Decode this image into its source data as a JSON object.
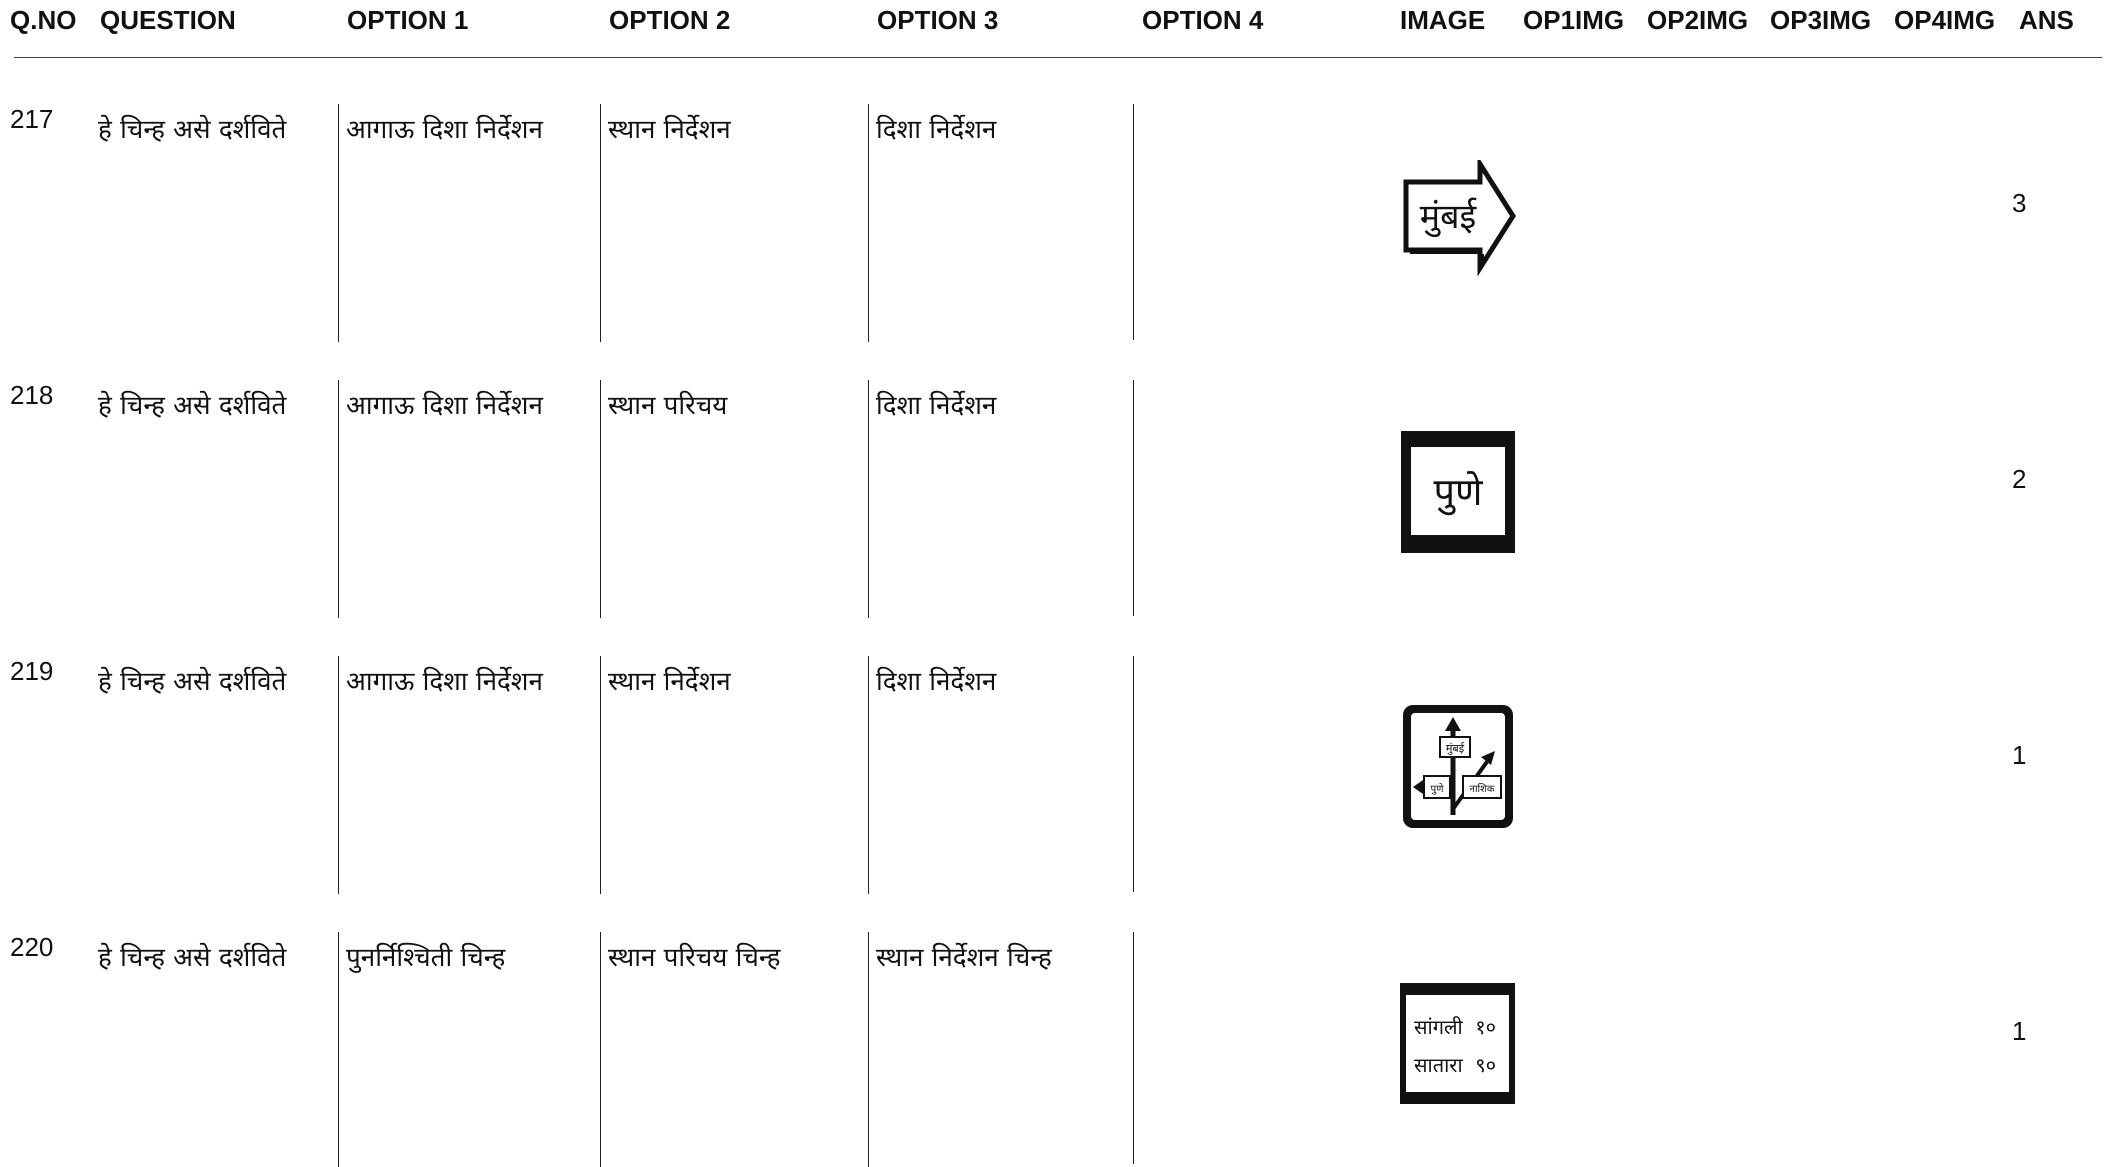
{
  "headers": [
    "Q.NO",
    "QUESTION",
    "OPTION 1",
    "OPTION 2",
    "OPTION 3",
    "OPTION 4",
    "IMAGE",
    "OP1IMG",
    "OP2IMG",
    "OP3IMG",
    "OP4IMG",
    "ANS"
  ],
  "rows": [
    {
      "qno": "217",
      "question": "हे चिन्ह असे दर्शविते",
      "option1": "आगाऊ दिशा निर्देशन",
      "option2": "स्थान निर्देशन",
      "option3": "दिशा निर्देशन",
      "option4": "",
      "image_icon": "arrow-sign-icon",
      "image_text": "मुंबई",
      "ans": "3"
    },
    {
      "qno": "218",
      "question": "हे चिन्ह असे दर्शविते",
      "option1": "आगाऊ दिशा निर्देशन",
      "option2": "स्थान परिचय",
      "option3": "दिशा निर्देशन",
      "option4": "",
      "image_icon": "place-sign-icon",
      "image_text": "पुणे",
      "ans": "2"
    },
    {
      "qno": "219",
      "question": "हे चिन्ह असे दर्शविते",
      "option1": "आगाऊ दिशा निर्देशन",
      "option2": "स्थान निर्देशन",
      "option3": "दिशा निर्देशन",
      "option4": "",
      "image_icon": "direction-sign-icon",
      "image_labels": [
        "मुंबई",
        "पुणे",
        "नाशिक"
      ],
      "ans": "1"
    },
    {
      "qno": "220",
      "question": "हे चिन्ह असे दर्शविते",
      "option1": "पुनर्निश्चिती चिन्ह",
      "option2": "स्थान परिचय चिन्ह",
      "option3": "स्थान निर्देशन चिन्ह",
      "option4": "",
      "image_icon": "distance-sign-icon",
      "image_lines": [
        {
          "place": "सांगली",
          "km": "१०"
        },
        {
          "place": "सातारा",
          "km": "९०"
        }
      ],
      "ans": "1"
    }
  ]
}
